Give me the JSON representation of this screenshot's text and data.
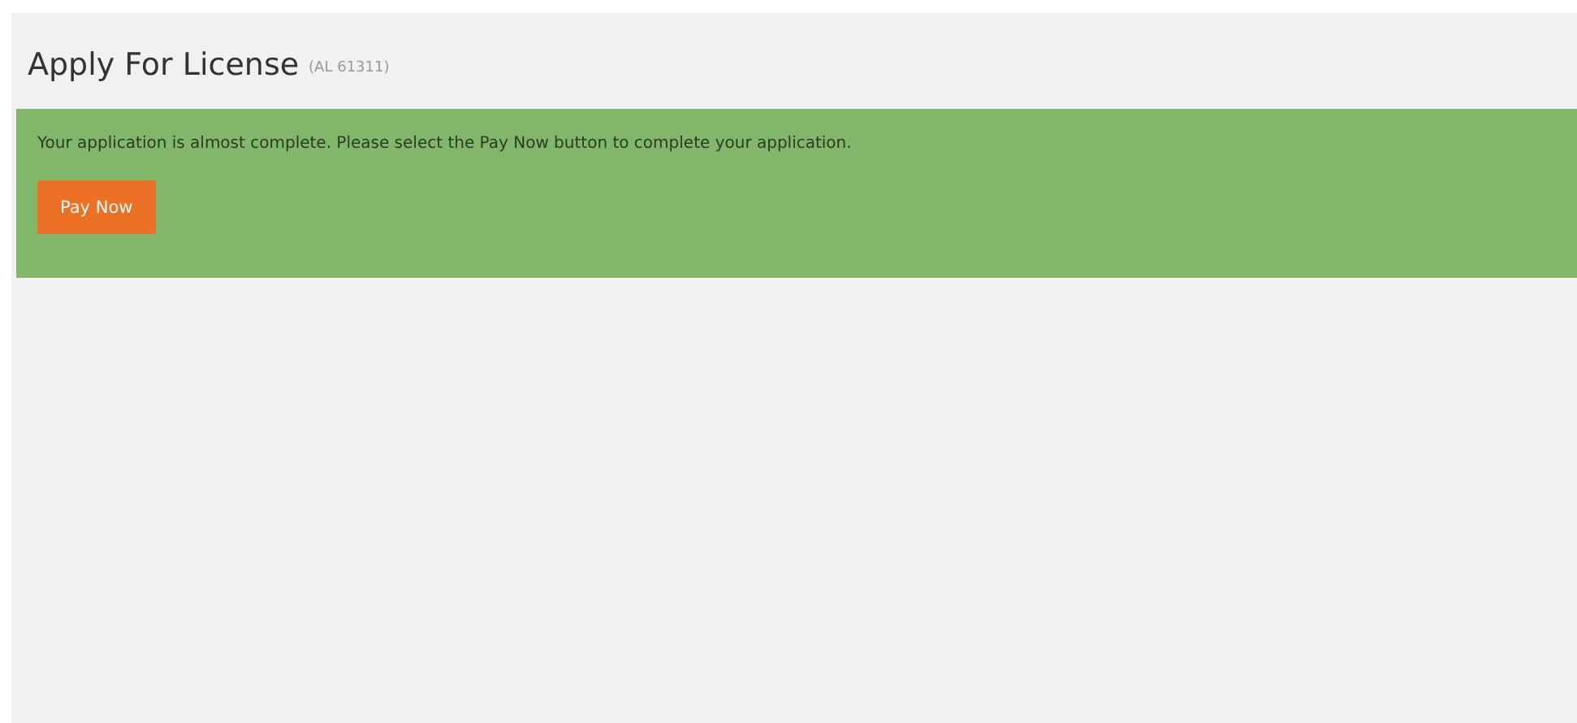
{
  "page": {
    "title": "Apply For License",
    "reference": "(AL 61311)"
  },
  "banner": {
    "message": "Your application is almost complete. Please select the Pay Now button to complete your application.",
    "button": "Pay Now"
  }
}
